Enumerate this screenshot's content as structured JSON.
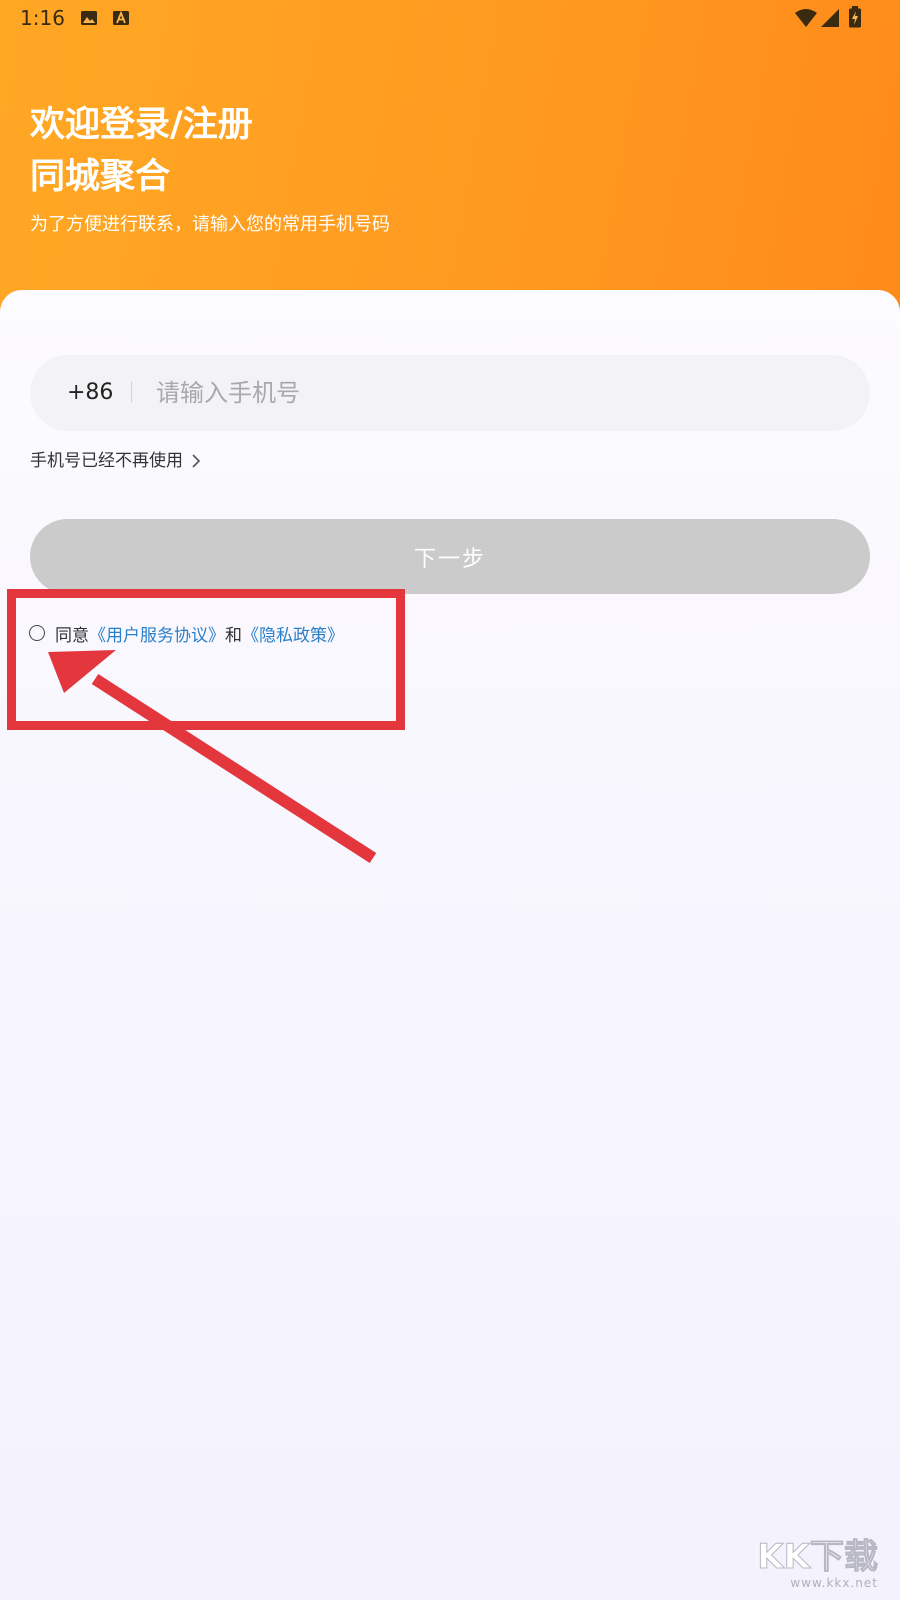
{
  "status_bar": {
    "time": "1:16",
    "icons": [
      "image-icon",
      "a-icon",
      "wifi-icon",
      "signal-icon",
      "battery-charging-icon"
    ]
  },
  "header": {
    "title_line1": "欢迎登录/注册",
    "title_line2": "同城聚合",
    "subtitle": "为了方便进行联系，请输入您的常用手机号码"
  },
  "phone": {
    "country_code": "+86",
    "placeholder": "请输入手机号",
    "value": ""
  },
  "no_longer_link": "手机号已经不再使用",
  "next_button": "下一步",
  "agreement": {
    "prefix": "同意",
    "user_agreement": "《用户服务协议》",
    "conjunction": "和",
    "privacy_policy": "《隐私政策》",
    "checked": false
  },
  "watermark": {
    "main": "KK下载",
    "url": "www.kkx.net"
  },
  "colors": {
    "header_gradient_start": "#ffa824",
    "header_gradient_end": "#ff8a1a",
    "button_disabled": "#cbcbcb",
    "link": "#2b7fc8",
    "annotation_red": "#e3373d"
  }
}
